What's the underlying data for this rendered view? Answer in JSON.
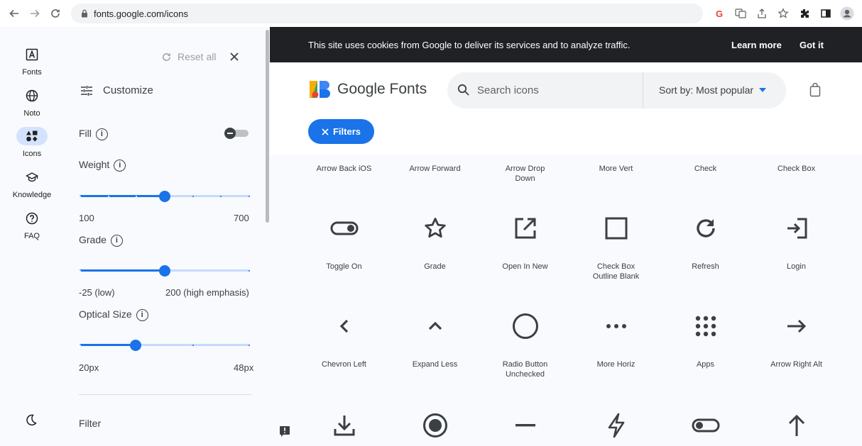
{
  "browser": {
    "url": "fonts.google.com/icons"
  },
  "rail": {
    "items": [
      {
        "label": "Fonts",
        "icon": "fonts-icon"
      },
      {
        "label": "Noto",
        "icon": "globe-icon"
      },
      {
        "label": "Icons",
        "icon": "shapes-icon"
      },
      {
        "label": "Knowledge",
        "icon": "school-icon"
      },
      {
        "label": "FAQ",
        "icon": "help-icon"
      }
    ],
    "theme_icon": "moon-icon"
  },
  "panel": {
    "reset_label": "Reset all",
    "title": "Customize",
    "fill_label": "Fill",
    "fill_on": false,
    "weight": {
      "label": "Weight",
      "min": "100",
      "max": "700",
      "value": 0.5
    },
    "grade": {
      "label": "Grade",
      "min": "-25 (low)",
      "max": "200 (high emphasis)",
      "value": 0.5
    },
    "optical": {
      "label": "Optical Size",
      "min": "20px",
      "max": "48px",
      "value": 0.33
    },
    "filter_label": "Filter"
  },
  "cookie": {
    "text": "This site uses cookies from Google to deliver its services and to analyze traffic.",
    "learn_more": "Learn more",
    "got_it": "Got it"
  },
  "header": {
    "logo_text": "Google Fonts",
    "search_placeholder": "Search icons",
    "sort_label": "Sort by: Most popular",
    "filters_label": "Filters"
  },
  "icons": {
    "row0": [
      "Arrow Back iOS",
      "Arrow Forward",
      "Arrow Drop\nDown",
      "More Vert",
      "Check",
      "Check Box"
    ],
    "row1": [
      "Toggle On",
      "Grade",
      "Open In New",
      "Check Box\nOutline Blank",
      "Refresh",
      "Login"
    ],
    "row2": [
      "Chevron Left",
      "Expand Less",
      "Radio Button\nUnchecked",
      "More Horiz",
      "Apps",
      "Arrow Right Alt"
    ],
    "row3_icons": [
      "download-icon",
      "radio-button-checked-icon",
      "remove-icon",
      "bolt-icon",
      "toggle-off-icon",
      "arrow-upward-icon"
    ]
  },
  "colors": {
    "accent": "#1a73e8",
    "cookie_bg": "#202124",
    "panel_bg": "#f8fafd"
  }
}
